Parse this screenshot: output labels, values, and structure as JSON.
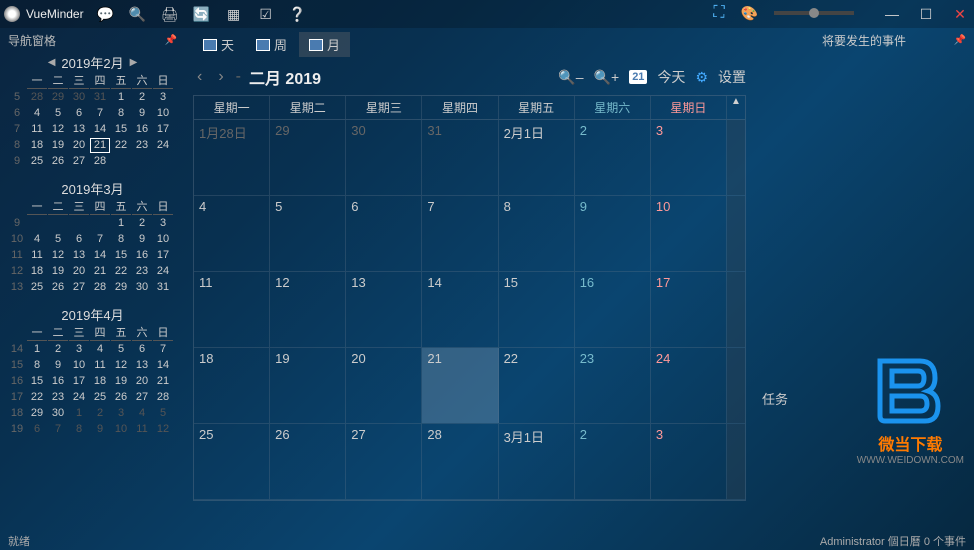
{
  "app": {
    "title": "VueMinder"
  },
  "toolbar_icons": [
    "speech-icon",
    "search-icon",
    "print-icon",
    "sync-icon",
    "grid-icon",
    "checklist-icon",
    "help-icon"
  ],
  "window_controls": {
    "min": "—",
    "max": "☐",
    "close": "✕"
  },
  "sidebar": {
    "header": "导航窗格",
    "months": [
      {
        "title": "2019年2月",
        "has_nav": true,
        "dow": [
          "一",
          "二",
          "三",
          "四",
          "五",
          "六",
          "日"
        ],
        "weeks": [
          {
            "wk": "5",
            "days": [
              {
                "n": "28",
                "dim": true
              },
              {
                "n": "29",
                "dim": true
              },
              {
                "n": "30",
                "dim": true
              },
              {
                "n": "31",
                "dim": true
              },
              {
                "n": "1"
              },
              {
                "n": "2"
              },
              {
                "n": "3"
              }
            ]
          },
          {
            "wk": "6",
            "days": [
              {
                "n": "4"
              },
              {
                "n": "5"
              },
              {
                "n": "6"
              },
              {
                "n": "7"
              },
              {
                "n": "8"
              },
              {
                "n": "9"
              },
              {
                "n": "10"
              }
            ]
          },
          {
            "wk": "7",
            "days": [
              {
                "n": "11"
              },
              {
                "n": "12"
              },
              {
                "n": "13"
              },
              {
                "n": "14"
              },
              {
                "n": "15"
              },
              {
                "n": "16"
              },
              {
                "n": "17"
              }
            ]
          },
          {
            "wk": "8",
            "days": [
              {
                "n": "18"
              },
              {
                "n": "19"
              },
              {
                "n": "20"
              },
              {
                "n": "21",
                "today": true
              },
              {
                "n": "22"
              },
              {
                "n": "23"
              },
              {
                "n": "24"
              }
            ]
          },
          {
            "wk": "9",
            "days": [
              {
                "n": "25"
              },
              {
                "n": "26"
              },
              {
                "n": "27"
              },
              {
                "n": "28"
              },
              {
                "n": ""
              },
              {
                "n": ""
              },
              {
                "n": ""
              }
            ]
          }
        ]
      },
      {
        "title": "2019年3月",
        "has_nav": false,
        "dow": [
          "一",
          "二",
          "三",
          "四",
          "五",
          "六",
          "日"
        ],
        "weeks": [
          {
            "wk": "9",
            "days": [
              {
                "n": ""
              },
              {
                "n": ""
              },
              {
                "n": ""
              },
              {
                "n": ""
              },
              {
                "n": "1"
              },
              {
                "n": "2"
              },
              {
                "n": "3"
              }
            ]
          },
          {
            "wk": "10",
            "days": [
              {
                "n": "4"
              },
              {
                "n": "5"
              },
              {
                "n": "6"
              },
              {
                "n": "7"
              },
              {
                "n": "8"
              },
              {
                "n": "9"
              },
              {
                "n": "10"
              }
            ]
          },
          {
            "wk": "11",
            "days": [
              {
                "n": "11"
              },
              {
                "n": "12"
              },
              {
                "n": "13"
              },
              {
                "n": "14"
              },
              {
                "n": "15"
              },
              {
                "n": "16"
              },
              {
                "n": "17"
              }
            ]
          },
          {
            "wk": "12",
            "days": [
              {
                "n": "18"
              },
              {
                "n": "19"
              },
              {
                "n": "20"
              },
              {
                "n": "21"
              },
              {
                "n": "22"
              },
              {
                "n": "23"
              },
              {
                "n": "24"
              }
            ]
          },
          {
            "wk": "13",
            "days": [
              {
                "n": "25"
              },
              {
                "n": "26"
              },
              {
                "n": "27"
              },
              {
                "n": "28"
              },
              {
                "n": "29"
              },
              {
                "n": "30"
              },
              {
                "n": "31"
              }
            ]
          }
        ]
      },
      {
        "title": "2019年4月",
        "has_nav": false,
        "dow": [
          "一",
          "二",
          "三",
          "四",
          "五",
          "六",
          "日"
        ],
        "weeks": [
          {
            "wk": "14",
            "days": [
              {
                "n": "1"
              },
              {
                "n": "2"
              },
              {
                "n": "3"
              },
              {
                "n": "4"
              },
              {
                "n": "5"
              },
              {
                "n": "6"
              },
              {
                "n": "7"
              }
            ]
          },
          {
            "wk": "15",
            "days": [
              {
                "n": "8"
              },
              {
                "n": "9"
              },
              {
                "n": "10"
              },
              {
                "n": "11"
              },
              {
                "n": "12"
              },
              {
                "n": "13"
              },
              {
                "n": "14"
              }
            ]
          },
          {
            "wk": "16",
            "days": [
              {
                "n": "15"
              },
              {
                "n": "16"
              },
              {
                "n": "17"
              },
              {
                "n": "18"
              },
              {
                "n": "19"
              },
              {
                "n": "20"
              },
              {
                "n": "21"
              }
            ]
          },
          {
            "wk": "17",
            "days": [
              {
                "n": "22"
              },
              {
                "n": "23"
              },
              {
                "n": "24"
              },
              {
                "n": "25"
              },
              {
                "n": "26"
              },
              {
                "n": "27"
              },
              {
                "n": "28"
              }
            ]
          },
          {
            "wk": "18",
            "days": [
              {
                "n": "29"
              },
              {
                "n": "30"
              },
              {
                "n": "1",
                "dim": true
              },
              {
                "n": "2",
                "dim": true
              },
              {
                "n": "3",
                "dim": true
              },
              {
                "n": "4",
                "dim": true
              },
              {
                "n": "5",
                "dim": true
              }
            ]
          },
          {
            "wk": "19",
            "days": [
              {
                "n": "6",
                "dim": true
              },
              {
                "n": "7",
                "dim": true
              },
              {
                "n": "8",
                "dim": true
              },
              {
                "n": "9",
                "dim": true
              },
              {
                "n": "10",
                "dim": true
              },
              {
                "n": "11",
                "dim": true
              },
              {
                "n": "12",
                "dim": true
              }
            ]
          }
        ]
      }
    ]
  },
  "main": {
    "view_tabs": [
      {
        "label": "天"
      },
      {
        "label": "周"
      },
      {
        "label": "月",
        "active": true
      }
    ],
    "month_label": "二月 2019",
    "today_num": "21",
    "today_lbl": "今天",
    "settings_lbl": "设置",
    "dow": [
      {
        "l": "星期一"
      },
      {
        "l": "星期二"
      },
      {
        "l": "星期三"
      },
      {
        "l": "星期四"
      },
      {
        "l": "星期五"
      },
      {
        "l": "星期六",
        "cls": "sat"
      },
      {
        "l": "星期日",
        "cls": "sun"
      }
    ],
    "weeks": [
      [
        {
          "l": "1月28日",
          "dim": true
        },
        {
          "l": "29",
          "dim": true
        },
        {
          "l": "30",
          "dim": true
        },
        {
          "l": "31",
          "dim": true
        },
        {
          "l": "2月1日"
        },
        {
          "l": "2",
          "sat": true
        },
        {
          "l": "3",
          "sun": true
        }
      ],
      [
        {
          "l": "4"
        },
        {
          "l": "5"
        },
        {
          "l": "6"
        },
        {
          "l": "7"
        },
        {
          "l": "8"
        },
        {
          "l": "9",
          "sat": true
        },
        {
          "l": "10",
          "sun": true
        }
      ],
      [
        {
          "l": "11"
        },
        {
          "l": "12"
        },
        {
          "l": "13"
        },
        {
          "l": "14"
        },
        {
          "l": "15"
        },
        {
          "l": "16",
          "sat": true
        },
        {
          "l": "17",
          "sun": true
        }
      ],
      [
        {
          "l": "18"
        },
        {
          "l": "19"
        },
        {
          "l": "20"
        },
        {
          "l": "21",
          "today": true
        },
        {
          "l": "22"
        },
        {
          "l": "23",
          "sat": true
        },
        {
          "l": "24",
          "sun": true
        }
      ],
      [
        {
          "l": "25"
        },
        {
          "l": "26"
        },
        {
          "l": "27"
        },
        {
          "l": "28"
        },
        {
          "l": "3月1日"
        },
        {
          "l": "2",
          "sat": true
        },
        {
          "l": "3",
          "sun": true
        }
      ]
    ]
  },
  "right": {
    "header": "将要发生的事件",
    "task_label": "任务"
  },
  "watermark": {
    "text": "微当下载",
    "url": "WWW.WEIDOWN.COM"
  },
  "status": {
    "left": "就绪",
    "right": "Administrator 個日曆 0 个事件"
  }
}
